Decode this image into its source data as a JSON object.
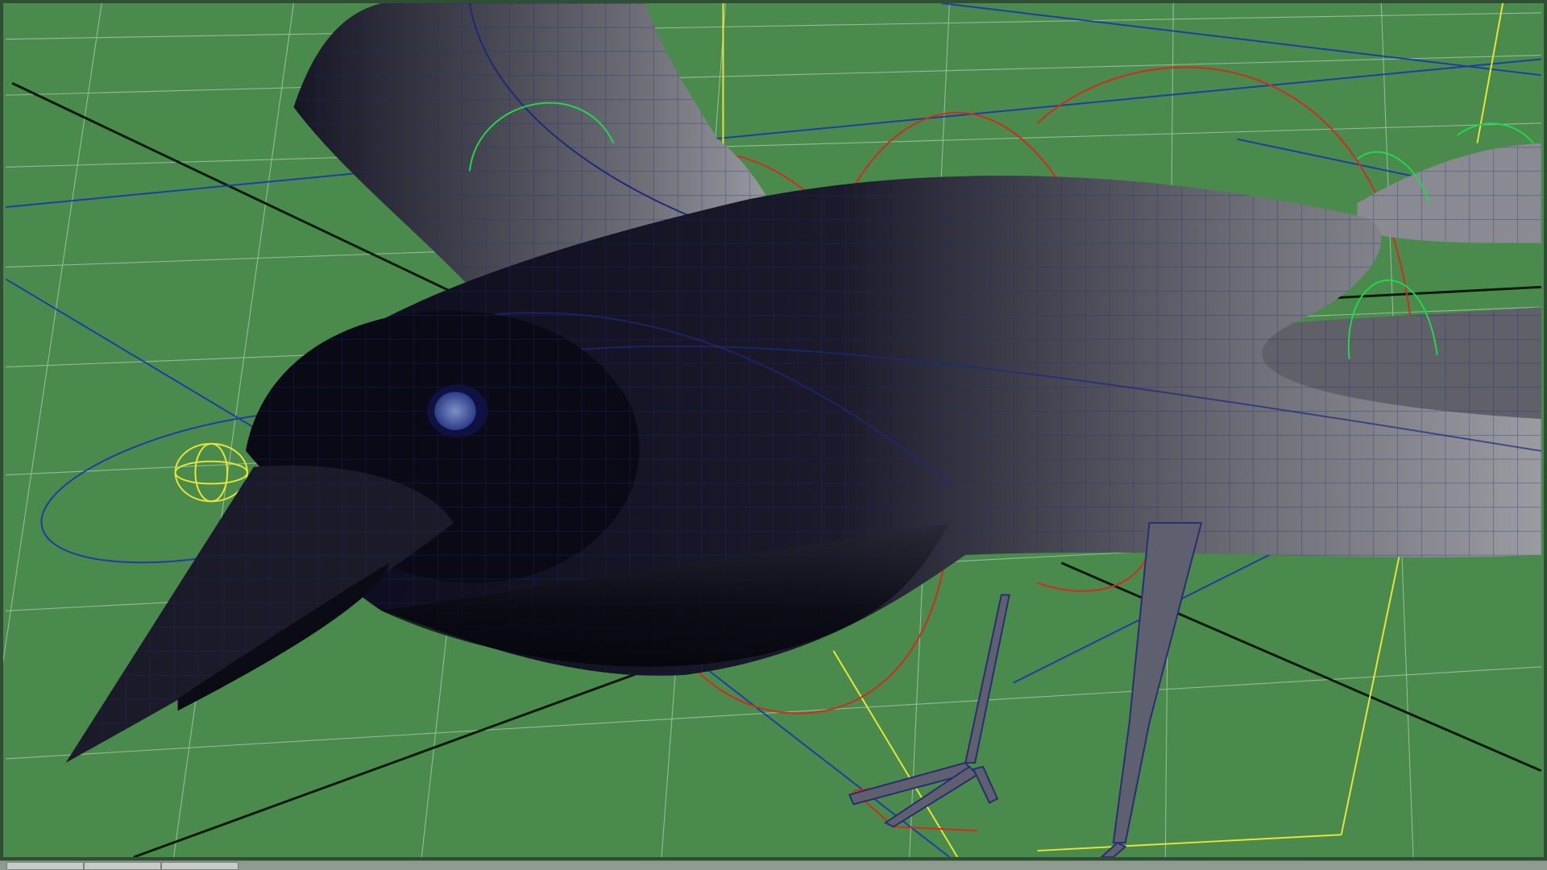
{
  "window": {
    "title": ""
  },
  "viewport": {
    "grid_color": "#aac7ab",
    "background_color": "#4a8a4c",
    "model_name": "crow",
    "controls": {
      "red": "#d22a1d",
      "green": "#1ed84b",
      "yellow": "#e8e53b",
      "blue": "#1e3eb5"
    }
  },
  "bottom_bar": {
    "tabs": [
      "",
      "",
      ""
    ]
  }
}
